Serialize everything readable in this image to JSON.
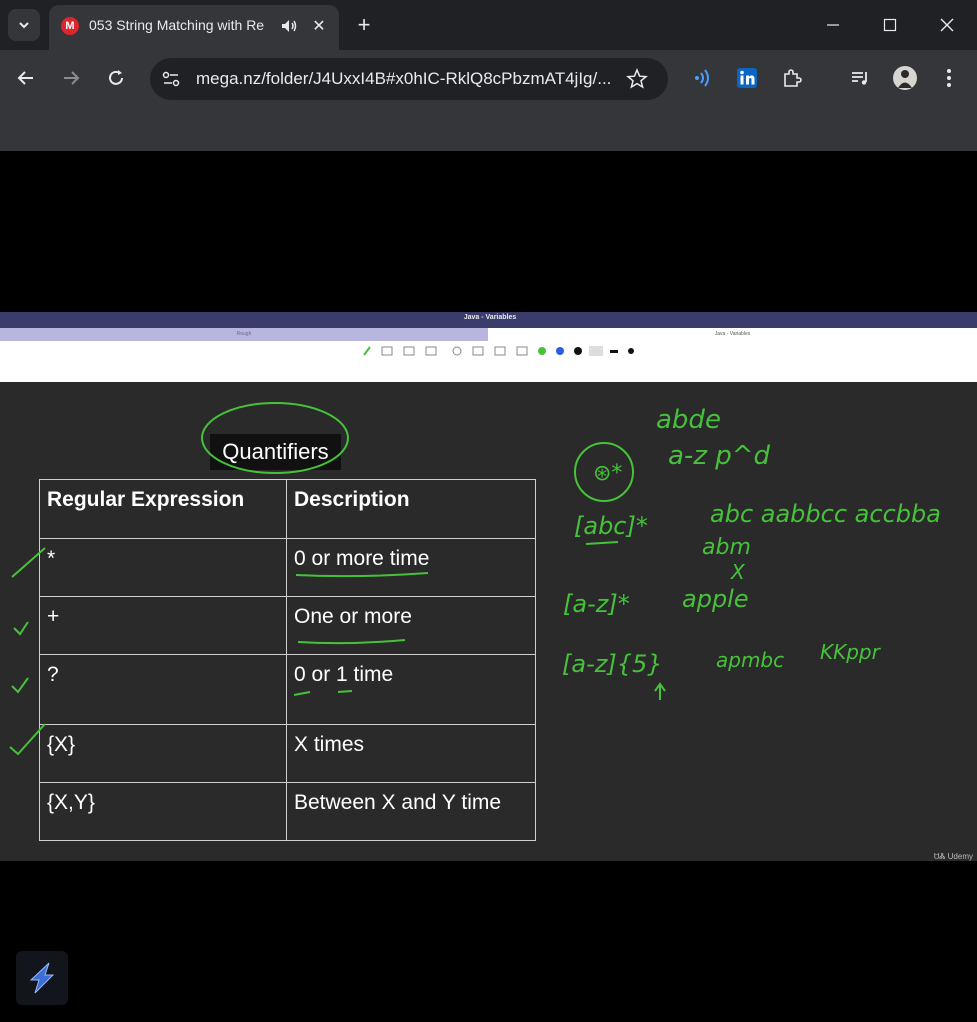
{
  "browser": {
    "tab": {
      "favicon_letter": "M",
      "title": "053 String Matching with Re"
    },
    "url": "mega.nz/folder/J4UxxI4B#x0hIC-RklQ8cPbzmAT4jIg/..."
  },
  "slide_app": {
    "title": "Java - Variables",
    "left_tab": "Rough",
    "right_tab": "Java - Variables"
  },
  "slide": {
    "heading": "Quantifiers",
    "table": {
      "headers": [
        "Regular Expression",
        "Description"
      ],
      "rows": [
        {
          "expr": "*",
          "desc": "0 or more time"
        },
        {
          "expr": "+",
          "desc": "One or more"
        },
        {
          "expr": "?",
          "desc": "0 or 1 time"
        },
        {
          "expr": "{X}",
          "desc": "X times"
        },
        {
          "expr": "{X,Y}",
          "desc": "Between X and Y time"
        }
      ]
    },
    "watermark": "Udemy",
    "handwriting": {
      "line1": "abde",
      "line2": "a-z p^d",
      "expr1": "[abc]*",
      "ex1": "abc   aabbcc   accbba",
      "ex1b": "abm",
      "ex1c": "X",
      "expr2": "[a-z]*",
      "ex2": "apple",
      "expr3": "[a-z]{5}",
      "ex3": "apmbc",
      "ex3b": "KKppr"
    }
  },
  "colors": {
    "chrome_bg": "#202124",
    "toolbar_bg": "#35363a",
    "ink": "#46c23a",
    "slide_bg": "#2a2a2a"
  }
}
